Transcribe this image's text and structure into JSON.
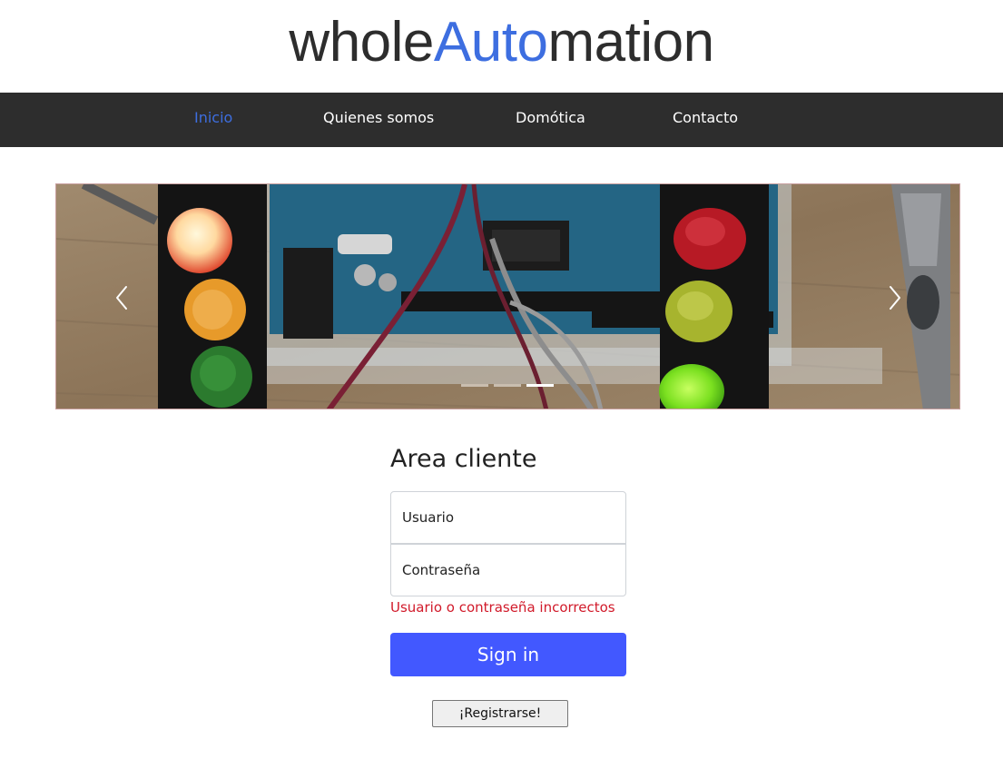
{
  "header": {
    "logo_part1": "whole",
    "logo_part2": "Auto",
    "logo_part3": "mation"
  },
  "nav": {
    "items": [
      {
        "label": "Inicio",
        "active": true
      },
      {
        "label": "Quienes somos",
        "active": false
      },
      {
        "label": "Domótica",
        "active": false
      },
      {
        "label": "Contacto",
        "active": false
      }
    ]
  },
  "carousel": {
    "slide_count": 3,
    "active_slide": 3,
    "prev_icon": "chevron-left-icon",
    "next_icon": "chevron-right-icon"
  },
  "login": {
    "title": "Area cliente",
    "username_placeholder": "Usuario",
    "password_placeholder": "Contraseña",
    "error": "Usuario o contraseña incorrectos",
    "signin_label": "Sign in",
    "register_label": "¡Registrarse!"
  },
  "colors": {
    "brand_accent": "#3d6ee0",
    "navbar_bg": "#2d2d2d",
    "signin_button": "#4258ff",
    "error_text": "#d11a2a"
  }
}
